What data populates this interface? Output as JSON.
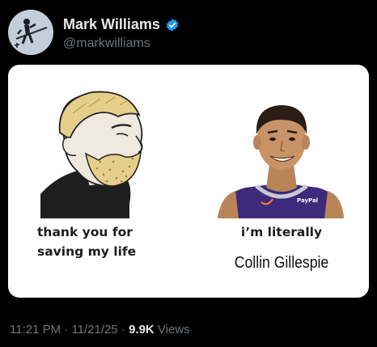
{
  "author": {
    "display_name": "Mark Williams",
    "handle": "@markwilliams",
    "verified_icon": "verified-badge-icon",
    "verified_color": "#1d9bf0"
  },
  "meme": {
    "left_caption": "thank you for saving my life",
    "right_caption_line1": "i’m literally",
    "right_caption_line2": "Collin Gillespie",
    "jersey_text": "PayPal"
  },
  "footer": {
    "time": "11:21 PM",
    "separator": "·",
    "date": "11/21/25",
    "views_count": "9.9K",
    "views_label": "Views"
  },
  "colors": {
    "background": "#000000",
    "card": "#ffffff",
    "muted_text": "#71767b",
    "primary_text": "#e7e9ea",
    "jersey_purple": "#3d2a7a"
  }
}
